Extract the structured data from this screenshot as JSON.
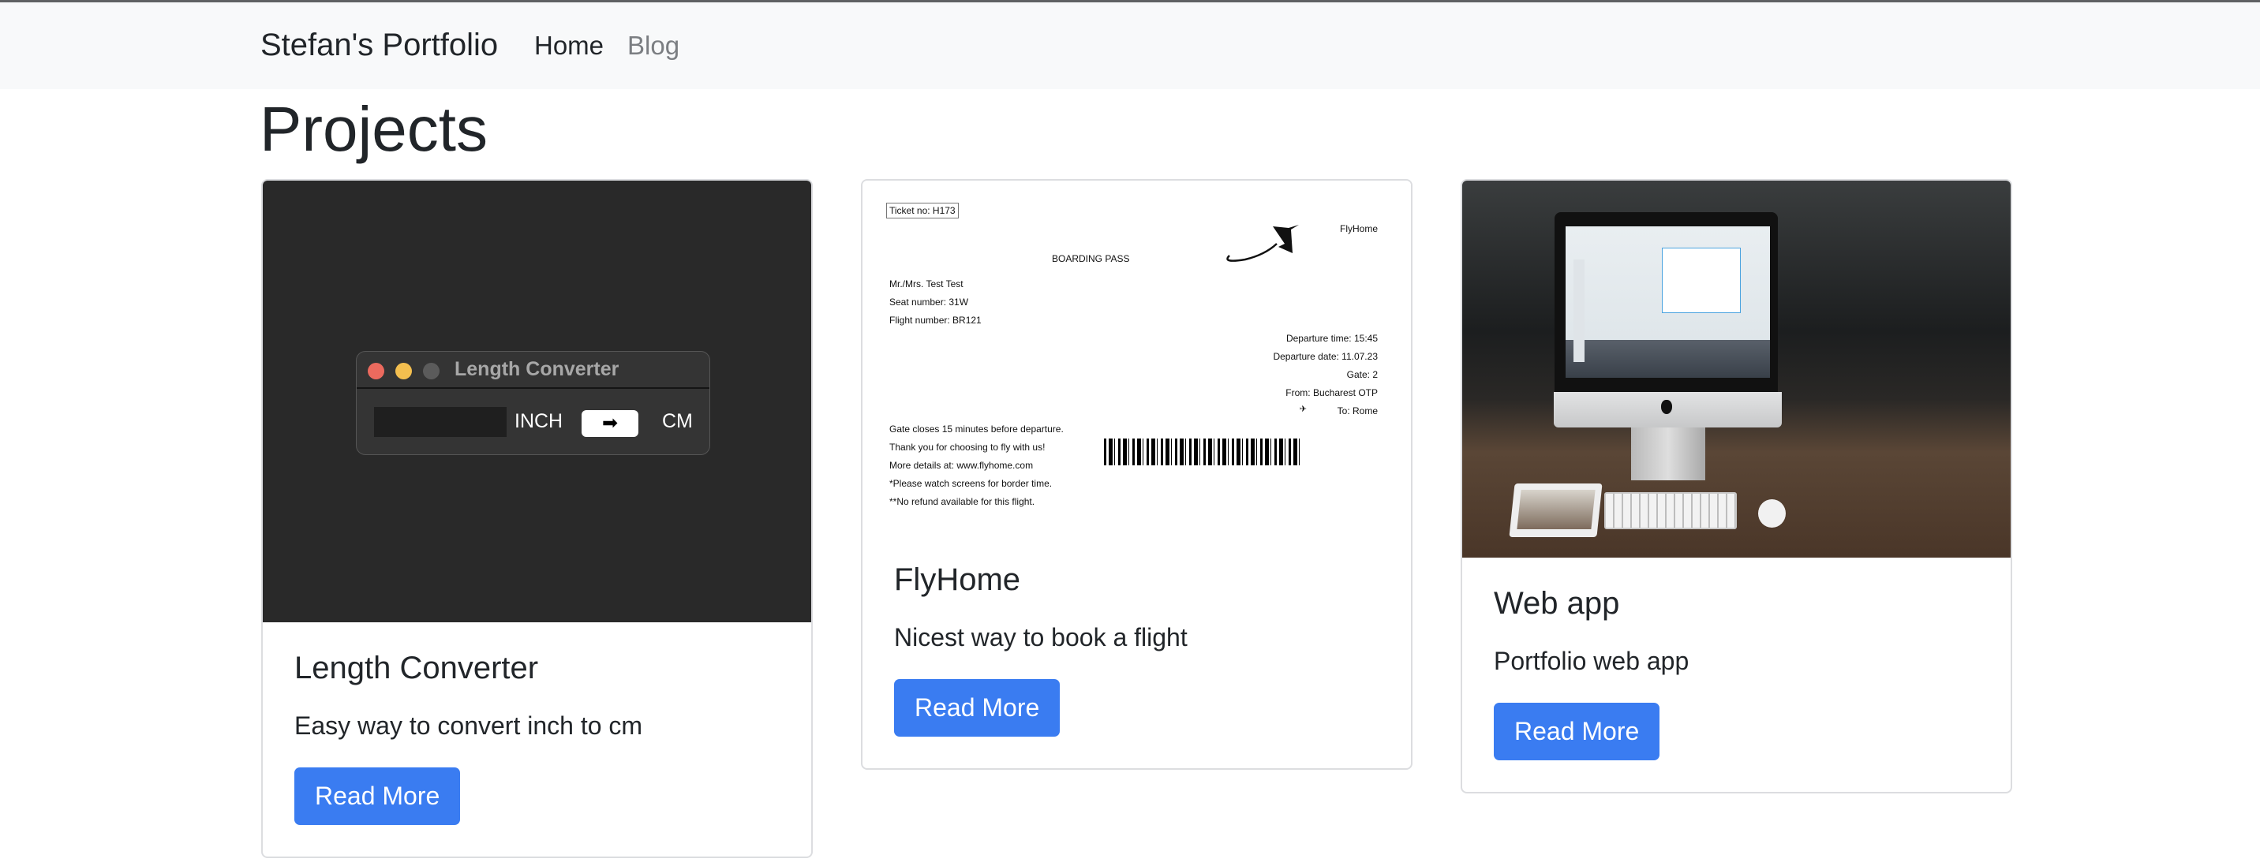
{
  "navbar": {
    "brand": "Stefan's Portfolio",
    "links": [
      {
        "label": "Home",
        "active": true
      },
      {
        "label": "Blog",
        "active": false
      }
    ]
  },
  "page_title": "Projects",
  "colors": {
    "accent": "#3a7cf1",
    "navbar_bg": "#f8f9fa"
  },
  "projects": [
    {
      "title": "Length Converter",
      "description": "Easy way to convert inch to cm",
      "button": "Read More",
      "preview": {
        "window_title": "Length Converter",
        "from_unit": "INCH",
        "to_unit": "CM",
        "button_icon": "arrow-right-icon",
        "button_glyph": "➡"
      }
    },
    {
      "title": "FlyHome",
      "description": "Nicest way to book a flight",
      "button": "Read More",
      "preview": {
        "ticket": "Ticket no: H173",
        "brand": "FlyHome",
        "heading": "BOARDING PASS",
        "passenger": "Mr./Mrs. Test Test",
        "seat": "Seat number: 31W",
        "flight": "Flight number: BR121",
        "departure_time": "Departure time: 15:45",
        "departure_date": "Departure date: 11.07.23",
        "gate": "Gate: 2",
        "from": "From: Bucharest OTP",
        "to": "To: Rome",
        "notes": [
          "Gate closes 15 minutes before departure.",
          "Thank you for choosing to fly with us!",
          "More details at: www.flyhome.com",
          "*Please watch screens for border time.",
          "**No refund available for this flight."
        ]
      }
    },
    {
      "title": "Web app",
      "description": "Portfolio web app",
      "button": "Read More",
      "preview": {
        "image": "imac-desk-photo"
      }
    }
  ]
}
